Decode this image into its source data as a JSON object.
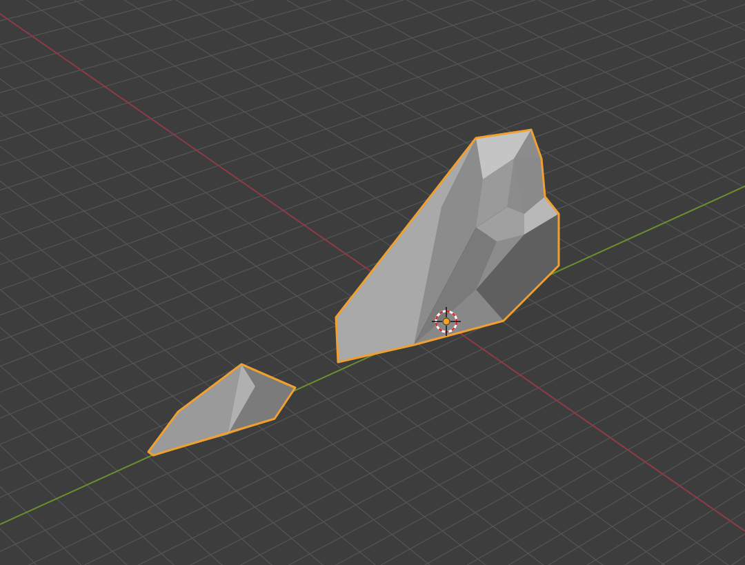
{
  "viewport": {
    "objects": [
      {
        "kind": "rock",
        "selected": true
      },
      {
        "kind": "rock",
        "selected": true
      }
    ]
  }
}
